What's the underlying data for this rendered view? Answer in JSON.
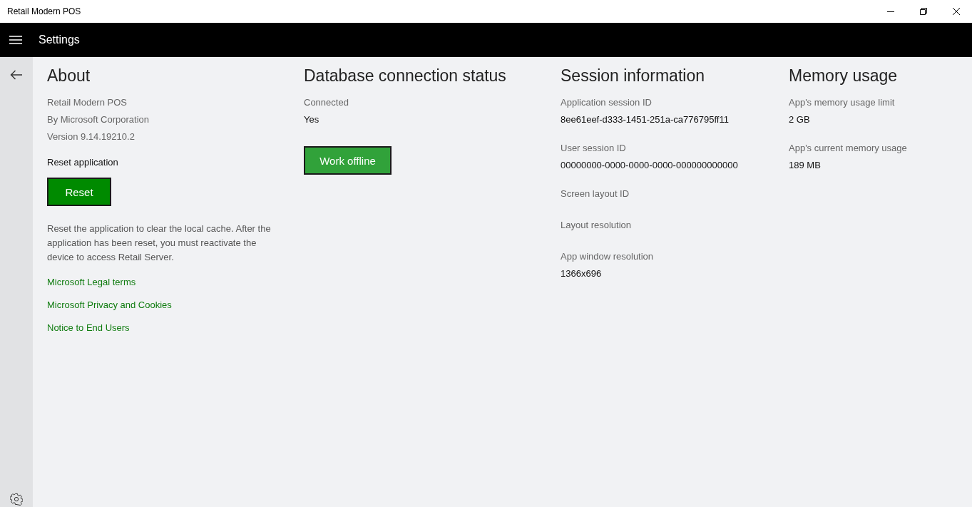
{
  "window": {
    "title": "Retail Modern POS"
  },
  "header": {
    "title": "Settings"
  },
  "sections": [
    {
      "title": "About",
      "items": [
        {
          "kind": "info",
          "text": "Retail Modern POS"
        },
        {
          "kind": "info",
          "text": "By Microsoft Corporation"
        },
        {
          "kind": "info",
          "text": "Version 9.14.19210.2"
        },
        {
          "kind": "label",
          "text": "Reset application"
        },
        {
          "kind": "button",
          "text": "Reset"
        },
        {
          "kind": "paragraph",
          "text": "Reset the application to clear the local cache. After the application has been reset, you must reactivate the device to access Retail Server."
        },
        {
          "kind": "link",
          "text": "Microsoft Legal terms"
        },
        {
          "kind": "link",
          "text": "Microsoft Privacy and Cookies"
        },
        {
          "kind": "link",
          "text": "Notice to End Users"
        }
      ]
    },
    {
      "title": "Database connection status",
      "items": [
        {
          "kind": "field",
          "label": "Connected",
          "value": "Yes"
        },
        {
          "kind": "button",
          "text": "Work offline"
        }
      ]
    },
    {
      "title": "Session information",
      "items": [
        {
          "kind": "field",
          "label": "Application session ID",
          "value": "8ee61eef-d333-1451-251a-ca776795ff11"
        },
        {
          "kind": "field",
          "label": "User session ID",
          "value": "00000000-0000-0000-0000-000000000000"
        },
        {
          "kind": "field",
          "label": "Screen layout ID"
        },
        {
          "kind": "field",
          "label": "Layout resolution"
        },
        {
          "kind": "field",
          "label": "App window resolution",
          "value": "1366x696"
        }
      ]
    },
    {
      "title": "Memory usage",
      "items": [
        {
          "kind": "field",
          "label": "App's memory usage limit",
          "value": "2 GB"
        },
        {
          "kind": "field",
          "label": "App's current memory usage",
          "value": "189 MB"
        }
      ]
    }
  ]
}
